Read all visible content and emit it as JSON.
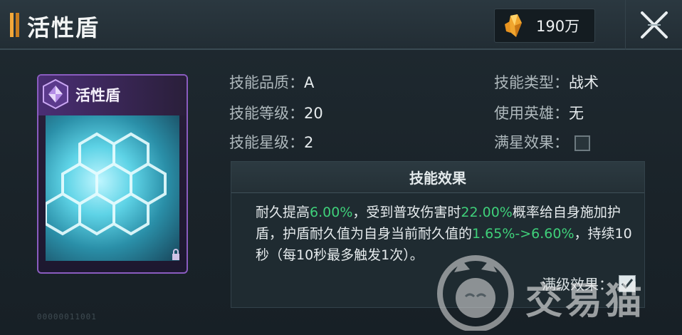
{
  "header": {
    "title": "活性盾",
    "currency_amount": "190万",
    "currency_icon": "crystal-icon",
    "close_icon": "close-icon"
  },
  "card": {
    "title": "活性盾",
    "badge_icon": "hexagon-skill-icon",
    "rarity_color": "#8a5cc0",
    "footer": "00000011001"
  },
  "stats": {
    "quality_label": "技能品质：",
    "quality_value": "A",
    "level_label": "技能等级：",
    "level_value": "20",
    "star_label": "技能星级：",
    "star_value": "2",
    "type_label": "技能类型：",
    "type_value": "战术",
    "hero_label": "使用英雄：",
    "hero_value": "无",
    "maxstar_label": "满星效果：",
    "maxstar_checked": false
  },
  "effect": {
    "title": "技能效果",
    "seg1": "耐久提高",
    "v1": "6.00%",
    "seg2": "，受到普攻伤害时",
    "v2": "22.00%",
    "seg3": "概率给自身施加护盾，护盾耐久值为自身当前耐久值的",
    "v3": "1.65%->6.60%",
    "seg4": "，持续10秒（每10秒最多触发1次）。",
    "maxlevel_label": "满级效果：",
    "maxlevel_checked": true,
    "highlight_color": "#3fd07a"
  },
  "watermark": {
    "text": "交易猫"
  }
}
